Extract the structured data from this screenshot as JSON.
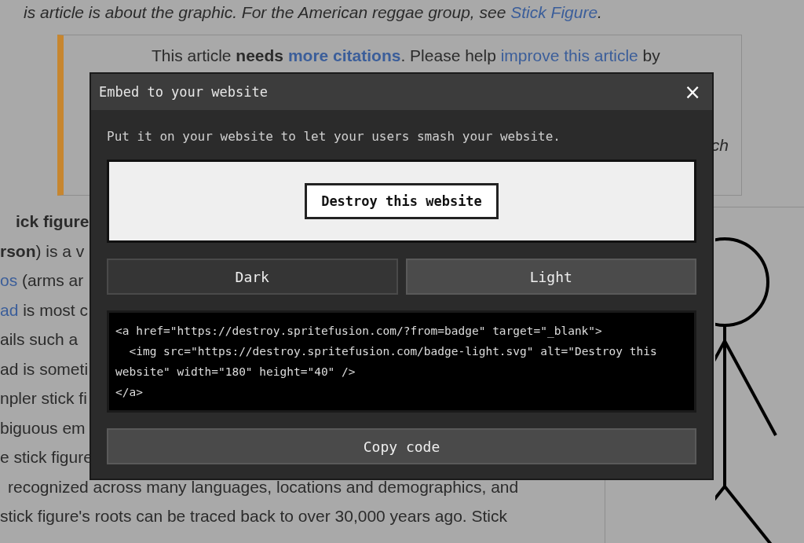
{
  "page": {
    "hatnote": [
      {
        "kind": "text",
        "text": "is article is about the graphic. For the American reggae group, see "
      },
      {
        "kind": "link",
        "text": "Stick Figure"
      },
      {
        "kind": "text",
        "text": "."
      }
    ],
    "banner": {
      "text": [
        {
          "kind": "text",
          "text": "This article "
        },
        {
          "kind": "bold",
          "text": "needs "
        },
        {
          "kind": "boldlink",
          "text": "more citations"
        },
        {
          "kind": "text",
          "text": ". Please help "
        },
        {
          "kind": "link",
          "text": "improve this article"
        },
        {
          "kind": "text",
          "text": " by"
        }
      ],
      "tail": "ch"
    },
    "lines": [
      [
        {
          "kind": "bold",
          "text": "ick figure"
        }
      ],
      [
        {
          "kind": "bold",
          "text": "rson"
        },
        {
          "kind": "text",
          "text": ") is a v"
        }
      ],
      [
        {
          "kind": "link",
          "text": "os"
        },
        {
          "kind": "text",
          "text": " (arms ar"
        }
      ],
      [
        {
          "kind": "link",
          "text": "ad"
        },
        {
          "kind": "text",
          "text": " is most c"
        }
      ],
      [
        {
          "kind": "text",
          "text": "ails such a"
        }
      ],
      [
        {
          "kind": "text",
          "text": "ad is someti"
        }
      ],
      [
        {
          "kind": "text",
          "text": "npler stick fi"
        }
      ],
      [
        {
          "kind": "text",
          "text": "biguous em"
        }
      ]
    ],
    "bottom_lines": [
      "e stick figure",
      "recognized across many languages, locations and demographics, and",
      "stick figure's roots can be traced back to over 30,000 years ago. Stick"
    ]
  },
  "dialog": {
    "title": "Embed to your website",
    "close": "×",
    "intro": "Put it on your website to let your users smash your website.",
    "preview_button": "Destroy this website",
    "themes": [
      {
        "label": "Dark",
        "selected": false
      },
      {
        "label": "Light",
        "selected": true
      }
    ],
    "code": "<a href=\"https://destroy.spritefusion.com/?from=badge\" target=\"_blank\">\n  <img src=\"https://destroy.spritefusion.com/badge-light.svg\" alt=\"Destroy this website\" width=\"180\" height=\"40\" />\n</a>",
    "copy_button": "Copy code"
  }
}
